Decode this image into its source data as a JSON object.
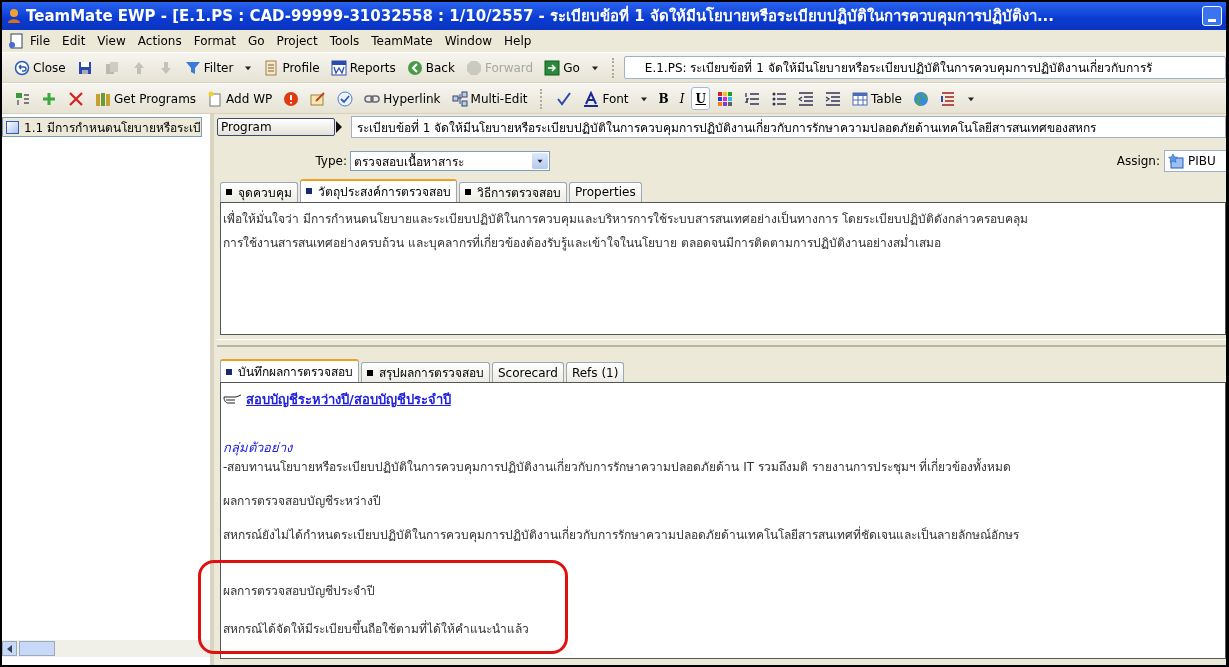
{
  "window": {
    "title": "TeamMate EWP - [E.1.PS : CAD-99999-31032558 : 1/10/2557 - ระเบียบข้อที่ 1 จัดให้มีนโยบายหรือระเบียบปฏิบัติในการควบคุมการปฏิบัติงา..."
  },
  "menu": [
    "File",
    "Edit",
    "View",
    "Actions",
    "Format",
    "Go",
    "Project",
    "Tools",
    "TeamMate",
    "Window",
    "Help"
  ],
  "toolbar": [
    {
      "kind": "button",
      "label": "Close",
      "disabled": false
    },
    {
      "kind": "button",
      "disabled": false
    },
    {
      "kind": "button",
      "disabled": true
    },
    {
      "kind": "button",
      "disabled": true
    },
    {
      "kind": "button",
      "disabled": true
    },
    {
      "kind": "button",
      "label": "Filter",
      "disabled": false
    },
    {
      "kind": "caret"
    },
    {
      "kind": "button",
      "label": "Profile",
      "disabled": false
    },
    {
      "kind": "button",
      "label": "Reports",
      "disabled": false
    },
    {
      "kind": "button",
      "label": "Back",
      "disabled": false
    },
    {
      "kind": "button",
      "label": "Forward",
      "disabled": true
    },
    {
      "kind": "button",
      "label": "Go",
      "disabled": false
    },
    {
      "kind": "caret"
    }
  ],
  "location": "E.1.PS: ระเบียบข้อที่ 1 จัดให้มีนโยบายหรือระเบียบปฏิบัติในการควบคุมการปฏิบัติงานเกี่ยวกับการรั",
  "format_toolbar": [
    {
      "kind": "button",
      "pressed": false
    },
    {
      "kind": "button",
      "pressed": false
    },
    {
      "kind": "button",
      "pressed": false
    },
    {
      "kind": "button",
      "label": "Get Programs",
      "pressed": false
    },
    {
      "kind": "button",
      "label": "Add WP",
      "pressed": false
    },
    {
      "kind": "button",
      "pressed": false
    },
    {
      "kind": "button",
      "pressed": false
    },
    {
      "kind": "button",
      "pressed": false
    },
    {
      "kind": "button",
      "label": "Hyperlink",
      "pressed": false
    },
    {
      "kind": "button",
      "label": "Multi-Edit",
      "pressed": false
    },
    {
      "kind": "separator"
    },
    {
      "kind": "button",
      "pressed": false
    },
    {
      "kind": "button",
      "label": "Font",
      "pressed": false
    },
    {
      "kind": "caret"
    },
    {
      "kind": "letter",
      "label": "B",
      "pressed": false
    },
    {
      "kind": "letter",
      "label": "I",
      "pressed": false
    },
    {
      "kind": "letter",
      "label": "U",
      "pressed": true
    },
    {
      "kind": "button",
      "pressed": false
    },
    {
      "kind": "button",
      "pressed": false
    },
    {
      "kind": "button",
      "pressed": false
    },
    {
      "kind": "button",
      "pressed": false
    },
    {
      "kind": "button",
      "pressed": false
    },
    {
      "kind": "button",
      "label": "Table",
      "pressed": false
    },
    {
      "kind": "button",
      "pressed": false
    },
    {
      "kind": "button",
      "pressed": false
    },
    {
      "kind": "caret"
    }
  ],
  "tree": [
    {
      "label": "1.1 มีการกำหนดนโยบายหรือระเบี",
      "selected": true
    }
  ],
  "program": {
    "label": "Program",
    "value": "ระเบียบข้อที่ 1 จัดให้มีนโยบายหรือระเบียบปฏิบัติในการควบคุมการปฏิบัติงานเกี่ยวกับการรักษาความปลอดภัยด้านเทคโนโลยีสารสนเทศของสหกร"
  },
  "type": {
    "label": "Type:",
    "value": "ตรวจสอบเนื้อหาสาระ"
  },
  "assign": {
    "label": "Assign:",
    "value": "PIBU"
  },
  "upper_tabs": [
    {
      "label": "จุดควบคุม",
      "marked": true,
      "selected": false
    },
    {
      "label": "วัตถุประสงค์การตรวจสอบ",
      "marked": true,
      "selected": true
    },
    {
      "label": "วิธีการตรวจสอบ",
      "marked": true,
      "selected": false
    },
    {
      "label": "Properties",
      "marked": false,
      "selected": false
    }
  ],
  "upper_text": [
    "เพื่อให้มั่นใจว่า มีการกำหนดนโยบายและระเบียบปฏิบัติในการควบคุมและบริหารการใช้ระบบสารสนเทศอย่างเป็นทางการ โดยระเบียบปฏิบัติดังกล่าวครอบคลุม",
    "การใช้งานสารสนเทศอย่างครบถ้วน และบุคลากรที่เกี่ยวข้องต้องรับรู้และเข้าใจในนโยบาย ตลอดจนมีการติดตามการปฏิบัติงานอย่างสม่ำเสมอ"
  ],
  "lower_tabs": [
    {
      "label": "บันทึกผลการตรวจสอบ",
      "marked": true,
      "selected": true
    },
    {
      "label": "สรุปผลการตรวจสอบ",
      "marked": true,
      "selected": false
    },
    {
      "label": "Scorecard",
      "marked": false,
      "selected": false
    },
    {
      "label": "Refs (1)",
      "marked": false,
      "selected": false
    }
  ],
  "lower_content": [
    {
      "kind": "link",
      "text": "สอบบัญชีระหว่างปี/สอบบัญชีประจำปี"
    },
    {
      "kind": "heading",
      "text": "กลุ่มตัวอย่าง"
    },
    {
      "kind": "para",
      "text": "-สอบทานนโยบายหรือระเบียบปฏิบัติในการควบคุมการปฏิบัติงานเกี่ยวกับการรักษาความปลอดภัยด้าน IT รวมถึงมติ รายงานการประชุมฯ ที่เกี่ยวข้องทั้งหมด"
    },
    {
      "kind": "para",
      "text": "ผลการตรวจสอบบัญชีระหว่างปี"
    },
    {
      "kind": "para",
      "text": "สหกรณ์ยังไม่ได้กำหนดระเบียบปฏิบัติในการควบคุมการปฏิบัติงานเกี่ยวกับการรักษาความปลอดภัยด้านเทคโนโลยีสารสนเทศที่ชัดเจนและเป็นลายลักษณ์อักษร"
    },
    {
      "kind": "highlight_box",
      "items": [
        "ผลการตรวจสอบบัญชีประจำปี",
        "สหกรณ์ได้จัดให้มีระเบียบขึ้นถือใช้ตามที่ได้ให้คำแนะนำแล้ว"
      ]
    }
  ]
}
